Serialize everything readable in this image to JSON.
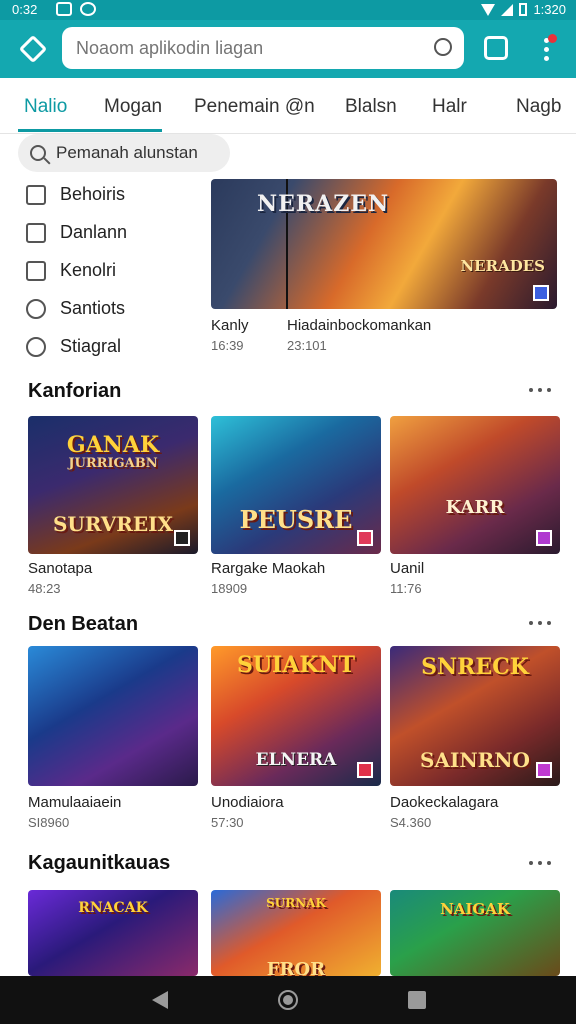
{
  "status_bar": {
    "time": "0:32",
    "clock_right": "1:320"
  },
  "app_bar": {
    "search_placeholder": "Noaom aplikodin liagan",
    "accent": "#14a8b0"
  },
  "tabs": [
    {
      "label": "Nalio",
      "active": true
    },
    {
      "label": "Mogan"
    },
    {
      "label": "Penemain @n"
    },
    {
      "label": "Blalsn"
    },
    {
      "label": "Halr"
    },
    {
      "label": "Nagb"
    }
  ],
  "filter": {
    "label": "Pemanah alunstan"
  },
  "categories": [
    {
      "label": "Behoiris"
    },
    {
      "label": "Danlann"
    },
    {
      "label": "Kenolri"
    },
    {
      "label": "Santiots"
    },
    {
      "label": "Stiagral"
    }
  ],
  "featured": {
    "title": "NERAZEN",
    "subtitle": "NERADES",
    "left_caption": "Kanly",
    "left_sub": "16:39",
    "right_caption": "Hiadainbockomankan",
    "right_sub": "23:101"
  },
  "sections": [
    {
      "title": "Kanforian",
      "cards": [
        {
          "title": "GANAK",
          "subtitle": "JURRIGABN",
          "bottom": "SURVREIX",
          "name": "Sanotapa",
          "meta": "48:23"
        },
        {
          "title": "",
          "subtitle": "",
          "bottom": "PEUSRE",
          "name": "Rargake Maokah",
          "meta": "18909"
        },
        {
          "title": "",
          "subtitle": "",
          "bottom": "KARR",
          "name": "Uanil",
          "meta": "11:76"
        }
      ]
    },
    {
      "title": "Den Beatan",
      "cards": [
        {
          "title": "",
          "subtitle": "",
          "bottom": "",
          "name": "Mamulaaiaein",
          "meta": "SI8960"
        },
        {
          "title": "SUIAKNT",
          "subtitle": "",
          "bottom": "ELNERA",
          "name": "Unodiaiora",
          "meta": "57:30"
        },
        {
          "title": "SNRECK",
          "subtitle": "",
          "bottom": "SAINRNO",
          "name": "Daokeckalagara",
          "meta": "S4.360"
        }
      ]
    },
    {
      "title": "Kagaunitkauas",
      "cards": [
        {
          "title": "RNACAK",
          "subtitle": "",
          "bottom": "",
          "name": "",
          "meta": ""
        },
        {
          "title": "SURNAK",
          "subtitle": "",
          "bottom": "FROR",
          "name": "",
          "meta": ""
        },
        {
          "title": "NAIGAK",
          "subtitle": "",
          "bottom": "",
          "name": "",
          "meta": ""
        }
      ]
    }
  ]
}
